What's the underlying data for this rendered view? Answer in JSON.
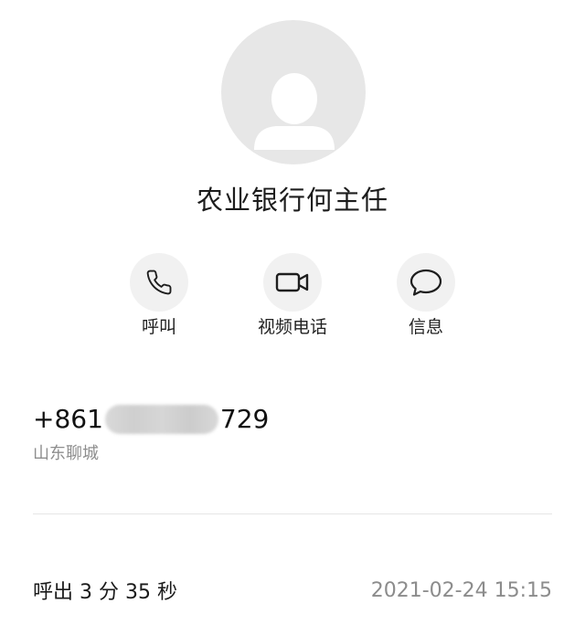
{
  "contact": {
    "name": "农业银行何主任",
    "avatar_icon": "person-placeholder-icon"
  },
  "actions": [
    {
      "label": "呼叫",
      "icon": "phone-icon"
    },
    {
      "label": "视频电话",
      "icon": "video-camera-icon"
    },
    {
      "label": "信息",
      "icon": "message-bubble-icon"
    }
  ],
  "number": {
    "prefix": "+861",
    "suffix": "729",
    "location": "山东聊城"
  },
  "call_log": {
    "summary": "呼出 3 分 35 秒",
    "timestamp": "2021-02-24 15:15"
  },
  "colors": {
    "avatar_bg": "#e7e7e7",
    "action_circle_bg": "#f1f1f1",
    "secondary_text": "#8e8e8e"
  }
}
